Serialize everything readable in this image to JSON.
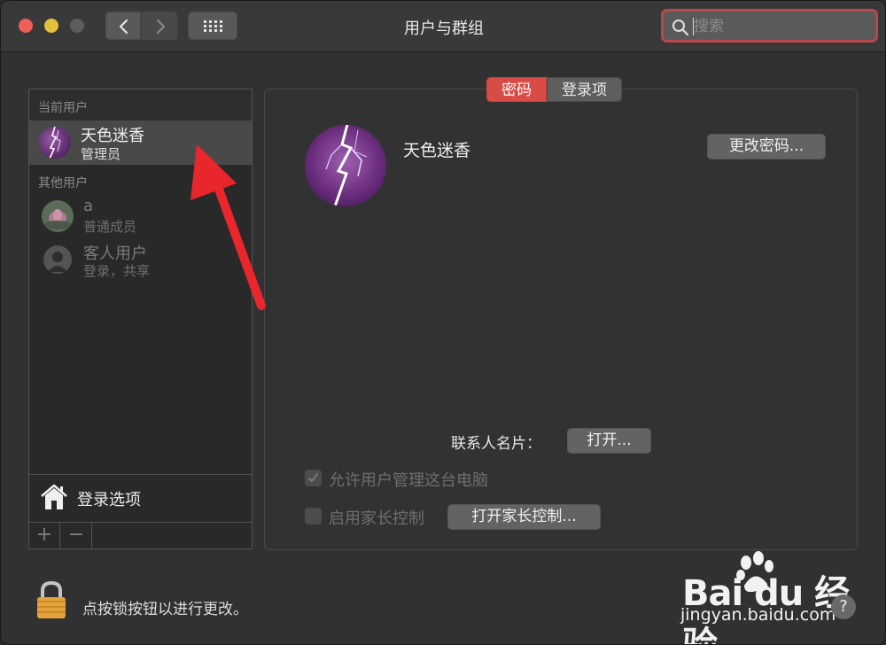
{
  "window": {
    "title": "用户与群组"
  },
  "search": {
    "placeholder": "搜索"
  },
  "sidebar": {
    "current_users_header": "当前用户",
    "current_user": {
      "name": "天色迷香",
      "role": "管理员"
    },
    "other_users_header": "其他用户",
    "other_users": [
      {
        "name": "a",
        "role": "普通成员"
      },
      {
        "name": "客人用户",
        "role": "登录，共享"
      }
    ],
    "login_options": "登录选项",
    "add_label": "+",
    "remove_label": "−"
  },
  "tabs": [
    {
      "label": "密码",
      "active": true
    },
    {
      "label": "登录项",
      "active": false
    }
  ],
  "main": {
    "user_name": "天色迷香",
    "change_password_button": "更改密码...",
    "contact_card_label": "联系人名片：",
    "open_button": "打开...",
    "allow_admin_label": "允许用户管理这台电脑",
    "allow_admin_checked": true,
    "parental_controls_label": "启用家长控制",
    "parental_controls_checked": false,
    "open_parental_button": "打开家长控制..."
  },
  "footer": {
    "lock_text": "点按锁按钮以进行更改。"
  },
  "watermark": {
    "brand": "Bai du 经验",
    "url": "jingyan.baidu.com"
  },
  "help_label": "?",
  "colors": {
    "accent_tab": "#d94c46",
    "search_focus": "#b8484b",
    "annotation_arrow": "#e8262c"
  }
}
